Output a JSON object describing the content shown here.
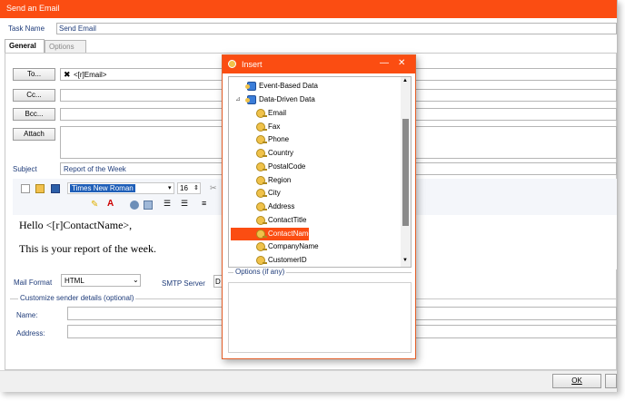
{
  "window": {
    "title": "Send an Email"
  },
  "task": {
    "label": "Task Name",
    "value": "Send Email"
  },
  "tabs": [
    {
      "label": "General"
    },
    {
      "label": "Options"
    }
  ],
  "recipients": {
    "to_label": "To...",
    "to_value": "<[r]Email>",
    "cc_label": "Cc...",
    "bcc_label": "Bcc...",
    "attach_label": "Attach"
  },
  "subject": {
    "label": "Subject",
    "value": "Report of the Week"
  },
  "editor": {
    "font_name": "Times New Roman",
    "font_size": "16",
    "line1": "Hello <[r]ContactName>,",
    "line2": "This is your report of the week."
  },
  "mail_format": {
    "label": "Mail Format",
    "value": "HTML"
  },
  "smtp": {
    "label": "SMTP Server",
    "value": "D"
  },
  "sender": {
    "legend": "Customize sender details (optional)",
    "name_label": "Name:",
    "address_label": "Address:"
  },
  "buttons": {
    "ok": "OK"
  },
  "insert_dialog": {
    "title": "Insert",
    "minimize": "—",
    "close": "✕",
    "tree": [
      {
        "label": "Event-Based Data",
        "type": "db",
        "indent": 0
      },
      {
        "label": "Data-Driven Data",
        "type": "db",
        "indent": 0,
        "expander": "⊿"
      },
      {
        "label": "Email",
        "type": "key",
        "indent": 1
      },
      {
        "label": "Fax",
        "type": "key",
        "indent": 1
      },
      {
        "label": "Phone",
        "type": "key",
        "indent": 1
      },
      {
        "label": "Country",
        "type": "key",
        "indent": 1
      },
      {
        "label": "PostalCode",
        "type": "key",
        "indent": 1
      },
      {
        "label": "Region",
        "type": "key",
        "indent": 1
      },
      {
        "label": "City",
        "type": "key",
        "indent": 1
      },
      {
        "label": "Address",
        "type": "key",
        "indent": 1
      },
      {
        "label": "ContactTitle",
        "type": "key",
        "indent": 1
      },
      {
        "label": "ContactName",
        "type": "key",
        "indent": 1,
        "selected": true
      },
      {
        "label": "CompanyName",
        "type": "key",
        "indent": 1
      },
      {
        "label": "CustomerID",
        "type": "key",
        "indent": 1
      }
    ],
    "options_legend": "Options (if any)"
  },
  "colors": {
    "accent": "#fb4d12",
    "label_blue": "#1f3c7a"
  }
}
